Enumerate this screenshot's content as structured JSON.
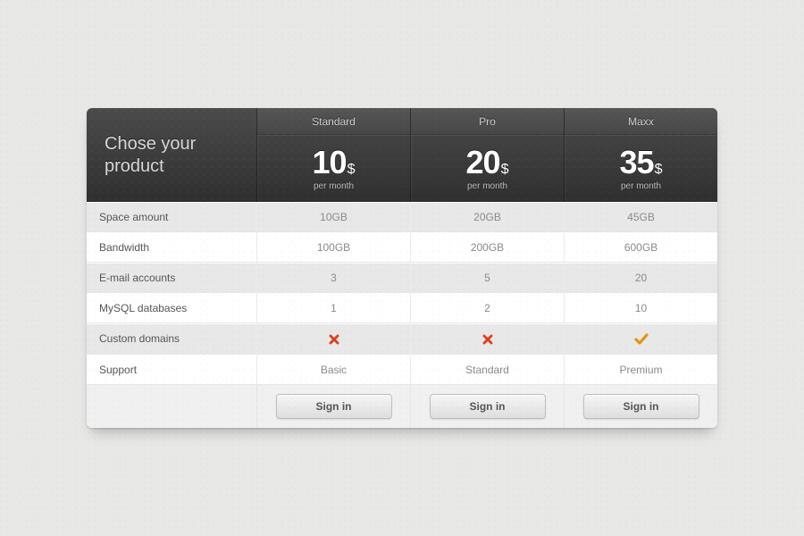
{
  "title": "Chose your product",
  "currency": "$",
  "period": "per month",
  "cta": "Sign in",
  "plans": [
    {
      "name": "Standard",
      "price": "10"
    },
    {
      "name": "Pro",
      "price": "20"
    },
    {
      "name": "Maxx",
      "price": "35"
    }
  ],
  "features": [
    {
      "label": "Space amount",
      "values": [
        "10GB",
        "20GB",
        "45GB"
      ]
    },
    {
      "label": "Bandwidth",
      "values": [
        "100GB",
        "200GB",
        "600GB"
      ]
    },
    {
      "label": "E-mail accounts",
      "values": [
        "3",
        "5",
        "20"
      ]
    },
    {
      "label": "MySQL databases",
      "values": [
        "1",
        "2",
        "10"
      ]
    },
    {
      "label": "Custom domains",
      "values": [
        "cross",
        "cross",
        "check"
      ]
    },
    {
      "label": "Support",
      "values": [
        "Basic",
        "Standard",
        "Premium"
      ]
    }
  ],
  "icons": {
    "cross": "cross-icon",
    "check": "check-icon"
  }
}
